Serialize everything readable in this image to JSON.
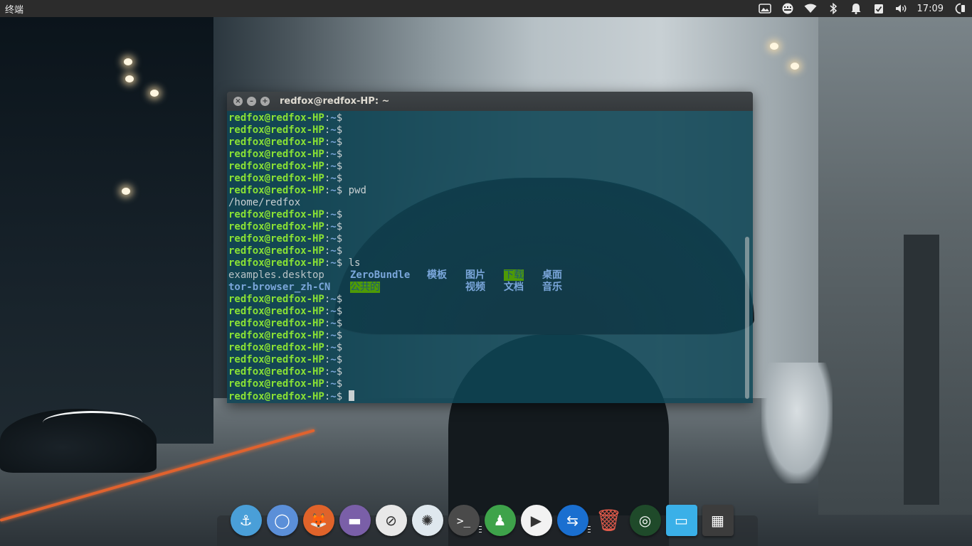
{
  "top_panel": {
    "app_name": "终端",
    "tray_icons": [
      "screenshot-icon",
      "keyboard-icon",
      "wifi-icon",
      "bluetooth-icon",
      "notification-bell-icon",
      "checklist-icon",
      "volume-icon"
    ],
    "clock": "17:09",
    "power_icon": "power-icon"
  },
  "terminal": {
    "title": "redfox@redfox-HP: ~",
    "prompt": {
      "user_host": "redfox@redfox-HP",
      "colon": ":",
      "path": "~",
      "dollar": "$"
    },
    "lines": [
      {
        "type": "prompt",
        "cmd": ""
      },
      {
        "type": "prompt",
        "cmd": ""
      },
      {
        "type": "prompt",
        "cmd": ""
      },
      {
        "type": "prompt",
        "cmd": ""
      },
      {
        "type": "prompt",
        "cmd": ""
      },
      {
        "type": "prompt",
        "cmd": ""
      },
      {
        "type": "prompt",
        "cmd": " pwd"
      },
      {
        "type": "output",
        "text": "/home/redfox"
      },
      {
        "type": "prompt",
        "cmd": ""
      },
      {
        "type": "prompt",
        "cmd": ""
      },
      {
        "type": "prompt",
        "cmd": ""
      },
      {
        "type": "prompt",
        "cmd": ""
      },
      {
        "type": "prompt",
        "cmd": " ls"
      },
      {
        "type": "ls",
        "cells": [
          {
            "text": "examples.desktop",
            "kind": "file"
          },
          {
            "text": "ZeroBundle",
            "kind": "dir"
          },
          {
            "text": "模板",
            "kind": "dir"
          },
          {
            "text": "图片",
            "kind": "dir"
          },
          {
            "text": "下载",
            "kind": "sticky"
          },
          {
            "text": "桌面",
            "kind": "dir"
          }
        ]
      },
      {
        "type": "ls",
        "cells": [
          {
            "text": "tor-browser_zh-CN",
            "kind": "dir"
          },
          {
            "text": "公共的",
            "kind": "sticky"
          },
          {
            "text": "",
            "kind": "file"
          },
          {
            "text": "视频",
            "kind": "dir"
          },
          {
            "text": "文档",
            "kind": "dir"
          },
          {
            "text": "音乐",
            "kind": "dir"
          }
        ]
      },
      {
        "type": "prompt",
        "cmd": ""
      },
      {
        "type": "prompt",
        "cmd": ""
      },
      {
        "type": "prompt",
        "cmd": ""
      },
      {
        "type": "prompt",
        "cmd": ""
      },
      {
        "type": "prompt",
        "cmd": ""
      },
      {
        "type": "prompt",
        "cmd": ""
      },
      {
        "type": "prompt",
        "cmd": ""
      },
      {
        "type": "prompt",
        "cmd": ""
      },
      {
        "type": "prompt",
        "cmd": "",
        "cursor": true
      }
    ],
    "colors": {
      "prompt_user": "#8ae234",
      "prompt_path": "#7aa6da",
      "directory": "#7aa6da",
      "sticky_dir_bg": "#4e9a06",
      "background": "#0e4454"
    }
  },
  "dock": {
    "items": [
      {
        "name": "anchor-launcher-icon",
        "glyph": "⚓",
        "bg": "#4a9fd8"
      },
      {
        "name": "chromium-icon",
        "glyph": "◯",
        "bg": "#5b8fd8"
      },
      {
        "name": "firefox-icon",
        "glyph": "🦊",
        "bg": "#e0632a"
      },
      {
        "name": "files-icon",
        "glyph": "▬",
        "bg": "#7a5fa8"
      },
      {
        "name": "settings-toggle-icon",
        "glyph": "⊘",
        "bg": "#e8e8e8"
      },
      {
        "name": "shutter-icon",
        "glyph": "✺",
        "bg": "#dfe8ee"
      },
      {
        "name": "terminal-icon",
        "glyph": ">_",
        "bg": "#4a4a4a",
        "running": true
      },
      {
        "name": "system-lock-icon",
        "glyph": "♟",
        "bg": "#3ea34a"
      },
      {
        "name": "media-player-icon",
        "glyph": "▶",
        "bg": "#f2f2f2"
      },
      {
        "name": "teamviewer-icon",
        "glyph": "⇆",
        "bg": "#1a6fd0",
        "running": true
      },
      {
        "name": "trash-icon",
        "glyph": "🗑",
        "bg": "transparent"
      },
      {
        "name": "radar-icon",
        "glyph": "◎",
        "bg": "#1f4a2a"
      },
      {
        "name": "display-icon",
        "glyph": "▭",
        "bg": "#3ab0e8"
      },
      {
        "name": "workspaces-icon",
        "glyph": "▦",
        "bg": "#3c3c3c"
      }
    ]
  }
}
